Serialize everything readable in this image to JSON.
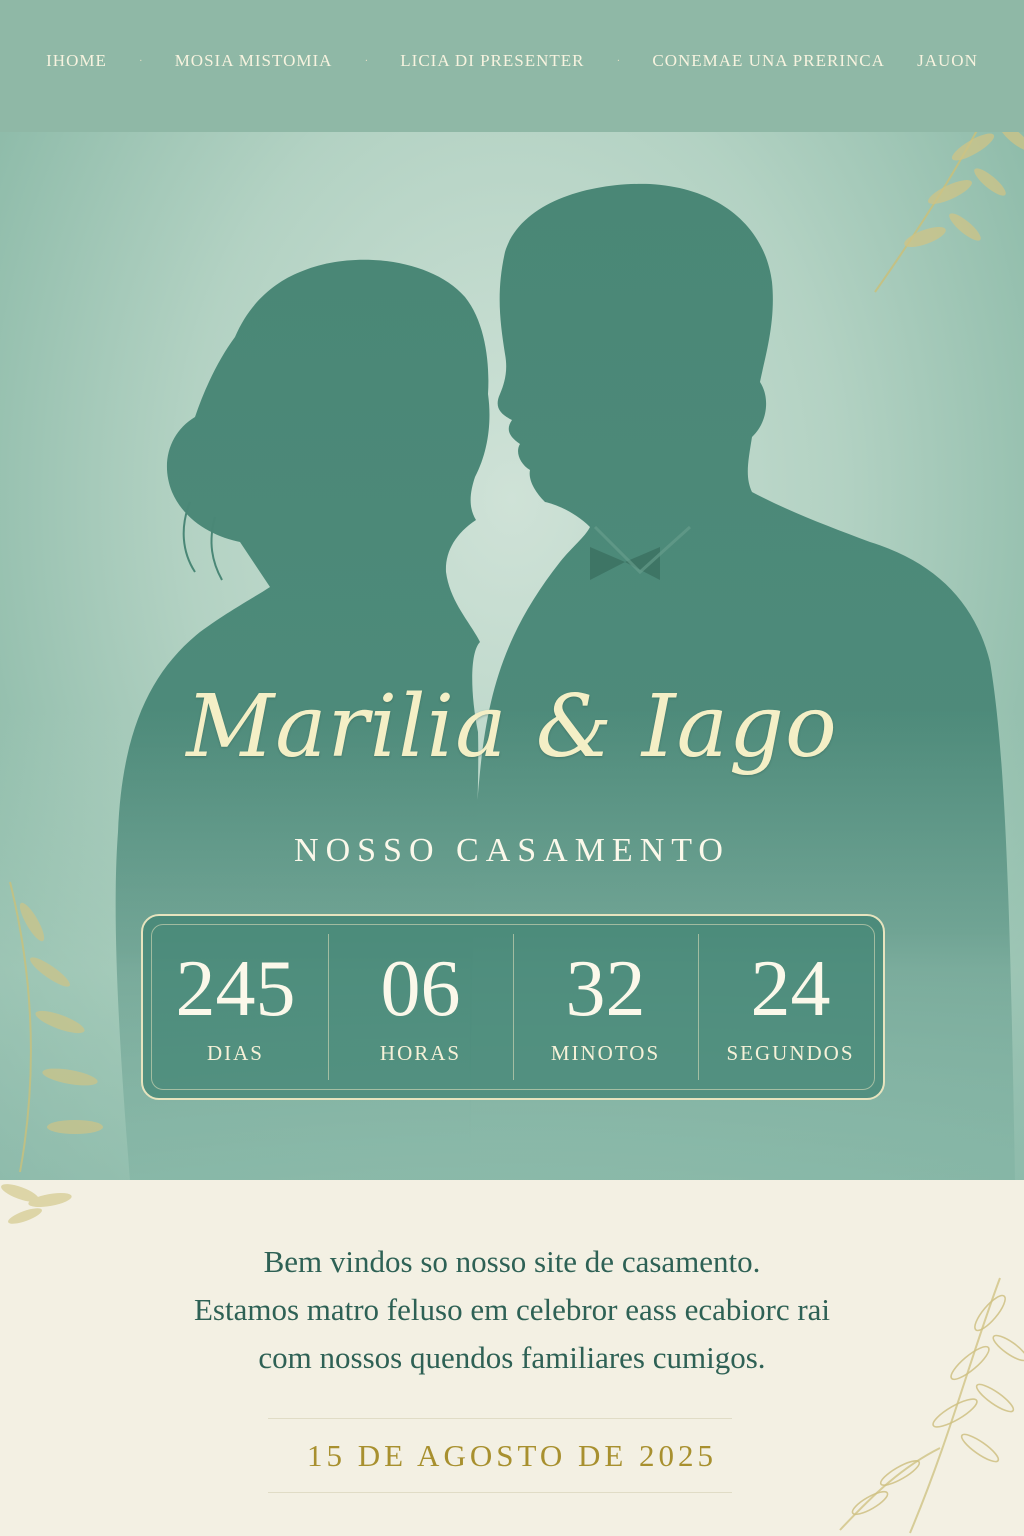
{
  "nav": {
    "items": [
      {
        "label": "IHOME"
      },
      {
        "label": "MOSIA MISTOMIA"
      },
      {
        "label": "LICIA DI PRESENTER"
      },
      {
        "label": "CONEMAE UNA PRERINCA"
      },
      {
        "label": "JAUON"
      }
    ]
  },
  "hero": {
    "names": "Marilia & Iago",
    "subtitle": "NOSSO CASAMENTO"
  },
  "countdown": {
    "days": {
      "value": "245",
      "label": "DIAS"
    },
    "hours": {
      "value": "06",
      "label": "HORAS"
    },
    "minutes": {
      "value": "32",
      "label": "MINOTOS"
    },
    "seconds": {
      "value": "24",
      "label": "SEGUNDOS"
    }
  },
  "welcome": {
    "line1": "Bem vindos so nosso site de casamento.",
    "line2": "Estamos matro feluso em celebror eass ecabiorc rai",
    "line3": "com nossos quendos familiares cumigos."
  },
  "event_date": "15 DE AGOSTO DE 2025",
  "colors": {
    "nav_bg": "#8fb8a6",
    "silhouette": "#4f8a7b",
    "accent_gold": "#a8902f",
    "cream": "#f3f0e3"
  }
}
